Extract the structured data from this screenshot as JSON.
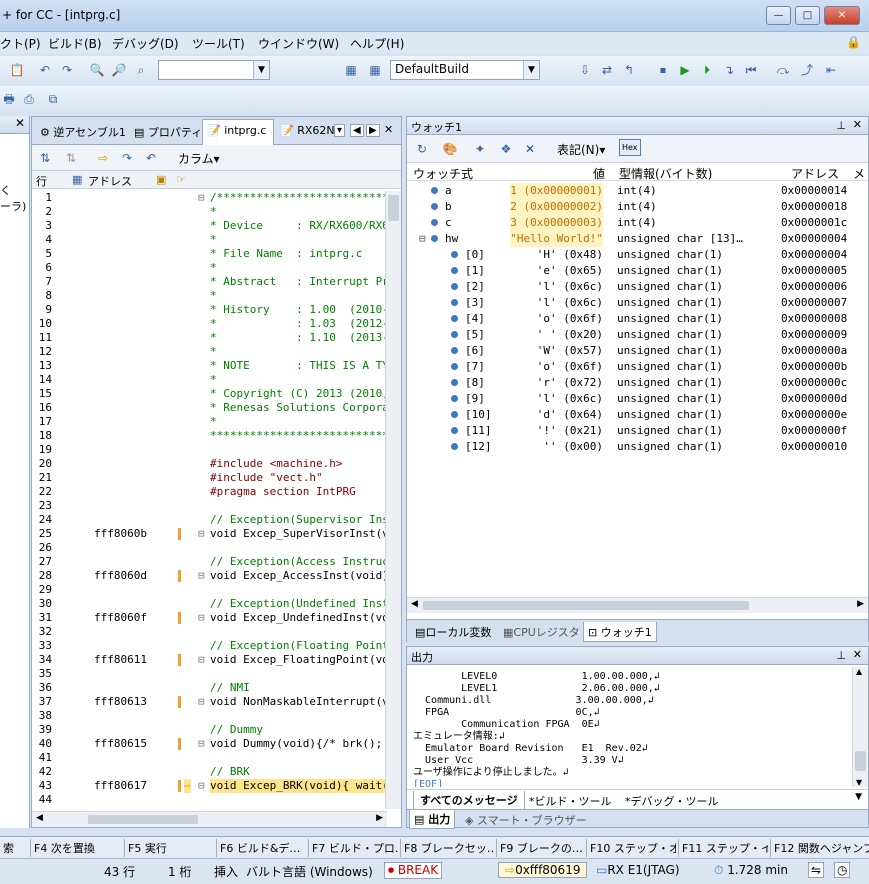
{
  "window": {
    "title": "+ for CC - [intprg.c]"
  },
  "menu": [
    "クト(P)",
    "ビルド(B)",
    "デバッグ(D)",
    "ツール(T)",
    "ウインドウ(W)",
    "ヘルプ(H)"
  ],
  "toolbar": {
    "build_config": "DefaultBuild"
  },
  "left_panel": {
    "items": [
      "く",
      "ーラ)"
    ]
  },
  "editor": {
    "tabs": [
      "逆アセンブル1",
      "プロパティ",
      "intprg.c",
      "RX62N_"
    ],
    "column_label": "カラム",
    "headers": {
      "line": "行",
      "address": "アドレス"
    },
    "lines": [
      {
        "n": "1",
        "addr": "",
        "text": "/***********************************",
        "cls": "cm",
        "fold": "⊟"
      },
      {
        "n": "2",
        "addr": "",
        "text": "*",
        "cls": "cm"
      },
      {
        "n": "3",
        "addr": "",
        "text": "* Device     : RX/RX600/RX62N",
        "cls": "cm"
      },
      {
        "n": "4",
        "addr": "",
        "text": "*",
        "cls": "cm"
      },
      {
        "n": "5",
        "addr": "",
        "text": "* File Name  : intprg.c",
        "cls": "cm"
      },
      {
        "n": "6",
        "addr": "",
        "text": "*",
        "cls": "cm"
      },
      {
        "n": "7",
        "addr": "",
        "text": "* Abstract   : Interrupt Pr",
        "cls": "cm"
      },
      {
        "n": "8",
        "addr": "",
        "text": "*",
        "cls": "cm"
      },
      {
        "n": "9",
        "addr": "",
        "text": "* History    : 1.00  (2010-",
        "cls": "cm"
      },
      {
        "n": "10",
        "addr": "",
        "text": "*            : 1.03  (2012-",
        "cls": "cm"
      },
      {
        "n": "11",
        "addr": "",
        "text": "*            : 1.10  (2013-",
        "cls": "cm"
      },
      {
        "n": "12",
        "addr": "",
        "text": "*",
        "cls": "cm"
      },
      {
        "n": "13",
        "addr": "",
        "text": "* NOTE       : THIS IS A TY",
        "cls": "cm"
      },
      {
        "n": "14",
        "addr": "",
        "text": "*",
        "cls": "cm"
      },
      {
        "n": "15",
        "addr": "",
        "text": "* Copyright (C) 2013 (2010,",
        "cls": "cm"
      },
      {
        "n": "16",
        "addr": "",
        "text": "* Renesas Solutions Corpora",
        "cls": "cm"
      },
      {
        "n": "17",
        "addr": "",
        "text": "*",
        "cls": "cm"
      },
      {
        "n": "18",
        "addr": "",
        "text": "***********************************",
        "cls": "cm"
      },
      {
        "n": "19",
        "addr": "",
        "text": "",
        "cls": ""
      },
      {
        "n": "20",
        "addr": "",
        "text": "#include <machine.h>",
        "cls": "pp"
      },
      {
        "n": "21",
        "addr": "",
        "text": "#include \"vect.h\"",
        "cls": "pp"
      },
      {
        "n": "22",
        "addr": "",
        "text": "#pragma section IntPRG",
        "cls": "pp"
      },
      {
        "n": "23",
        "addr": "",
        "text": "",
        "cls": ""
      },
      {
        "n": "24",
        "addr": "",
        "text": "// Exception(Supervisor Ins",
        "cls": "cm"
      },
      {
        "n": "25",
        "addr": "fff8060b",
        "text": "void Excep_SuperVisorInst(vo",
        "cls": "",
        "fold": "⊟",
        "mark": true
      },
      {
        "n": "26",
        "addr": "",
        "text": "",
        "cls": ""
      },
      {
        "n": "27",
        "addr": "",
        "text": "// Exception(Access Instruc",
        "cls": "cm"
      },
      {
        "n": "28",
        "addr": "fff8060d",
        "text": "void Excep_AccessInst(void)",
        "cls": "",
        "fold": "⊟",
        "mark": true
      },
      {
        "n": "29",
        "addr": "",
        "text": "",
        "cls": ""
      },
      {
        "n": "30",
        "addr": "",
        "text": "// Exception(Undefined Inst",
        "cls": "cm"
      },
      {
        "n": "31",
        "addr": "fff8060f",
        "text": "void Excep_UndefinedInst(vo",
        "cls": "",
        "fold": "⊟",
        "mark": true
      },
      {
        "n": "32",
        "addr": "",
        "text": "",
        "cls": ""
      },
      {
        "n": "33",
        "addr": "",
        "text": "// Exception(Floating Point",
        "cls": "cm"
      },
      {
        "n": "34",
        "addr": "fff80611",
        "text": "void Excep_FloatingPoint(vo",
        "cls": "",
        "fold": "⊟",
        "mark": true
      },
      {
        "n": "35",
        "addr": "",
        "text": "",
        "cls": ""
      },
      {
        "n": "36",
        "addr": "",
        "text": "// NMI",
        "cls": "cm"
      },
      {
        "n": "37",
        "addr": "fff80613",
        "text": "void NonMaskableInterrupt(v",
        "cls": "",
        "fold": "⊟",
        "mark": true
      },
      {
        "n": "38",
        "addr": "",
        "text": "",
        "cls": ""
      },
      {
        "n": "39",
        "addr": "",
        "text": "// Dummy",
        "cls": "cm"
      },
      {
        "n": "40",
        "addr": "fff80615",
        "text": "void Dummy(void){/* brk();",
        "cls": "",
        "fold": "⊟",
        "mark": true
      },
      {
        "n": "41",
        "addr": "",
        "text": "",
        "cls": ""
      },
      {
        "n": "42",
        "addr": "",
        "text": "// BRK",
        "cls": "cm"
      },
      {
        "n": "43",
        "addr": "fff80617",
        "text": "void Excep_BRK(void){ wait(",
        "cls": "",
        "fold": "⊟",
        "mark": true,
        "current": true
      },
      {
        "n": "44",
        "addr": "",
        "text": "",
        "cls": ""
      },
      {
        "n": "45",
        "addr": "",
        "text": "// RSC RUSEDD",
        "cls": "cm"
      }
    ]
  },
  "watch": {
    "title": "ウォッチ1",
    "notation_label": "表記(N)",
    "headers": {
      "expr": "ウォッチ式",
      "value": "値",
      "type": "型情報(バイト数)",
      "address": "アドレス",
      "more": "メ"
    },
    "rows": [
      {
        "name": "a",
        "value": "1 (0x00000001)",
        "type": "int(4)",
        "addr": "0x00000014",
        "indent": 0,
        "hl": true
      },
      {
        "name": "b",
        "value": "2 (0x00000002)",
        "type": "int(4)",
        "addr": "0x00000018",
        "indent": 0,
        "hl": true
      },
      {
        "name": "c",
        "value": "3 (0x00000003)",
        "type": "int(4)",
        "addr": "0x0000001c",
        "indent": 0,
        "hl": true
      },
      {
        "name": "hw",
        "value": "\"Hello World!\"",
        "type": "unsigned char [13]…",
        "addr": "0x00000004",
        "indent": 0,
        "hl": true,
        "expand": true
      },
      {
        "name": "[0]",
        "value": "'H' (0x48)",
        "type": "unsigned char(1)",
        "addr": "0x00000004",
        "indent": 1
      },
      {
        "name": "[1]",
        "value": "'e' (0x65)",
        "type": "unsigned char(1)",
        "addr": "0x00000005",
        "indent": 1
      },
      {
        "name": "[2]",
        "value": "'l' (0x6c)",
        "type": "unsigned char(1)",
        "addr": "0x00000006",
        "indent": 1
      },
      {
        "name": "[3]",
        "value": "'l' (0x6c)",
        "type": "unsigned char(1)",
        "addr": "0x00000007",
        "indent": 1
      },
      {
        "name": "[4]",
        "value": "'o' (0x6f)",
        "type": "unsigned char(1)",
        "addr": "0x00000008",
        "indent": 1
      },
      {
        "name": "[5]",
        "value": "' ' (0x20)",
        "type": "unsigned char(1)",
        "addr": "0x00000009",
        "indent": 1
      },
      {
        "name": "[6]",
        "value": "'W' (0x57)",
        "type": "unsigned char(1)",
        "addr": "0x0000000a",
        "indent": 1
      },
      {
        "name": "[7]",
        "value": "'o' (0x6f)",
        "type": "unsigned char(1)",
        "addr": "0x0000000b",
        "indent": 1
      },
      {
        "name": "[8]",
        "value": "'r' (0x72)",
        "type": "unsigned char(1)",
        "addr": "0x0000000c",
        "indent": 1
      },
      {
        "name": "[9]",
        "value": "'l' (0x6c)",
        "type": "unsigned char(1)",
        "addr": "0x0000000d",
        "indent": 1
      },
      {
        "name": "[10]",
        "value": "'d' (0x64)",
        "type": "unsigned char(1)",
        "addr": "0x0000000e",
        "indent": 1
      },
      {
        "name": "[11]",
        "value": "'!' (0x21)",
        "type": "unsigned char(1)",
        "addr": "0x0000000f",
        "indent": 1
      },
      {
        "name": "[12]",
        "value": "'' (0x00)",
        "type": "unsigned char(1)",
        "addr": "0x00000010",
        "indent": 1
      }
    ],
    "tabs": [
      "ローカル変数",
      "CPUレジスタ",
      "ウォッチ1"
    ]
  },
  "output": {
    "title": "出力",
    "lines": [
      "        LEVEL0              1.00.00.000,↲",
      "        LEVEL1              2.06.00.000,↲",
      "  Communi.dll              3.00.00.000,↲",
      "  FPGA                     0C,↲",
      "        Communication FPGA  0E↲",
      "エミュレータ情報:↲",
      "  Emulator Board Revision   E1  Rev.02↲",
      "  User Vcc                  3.39 V↲",
      "ユーザ操作により停止しました。↲",
      "[EOF]"
    ],
    "tabs": [
      "すべてのメッセージ",
      "*ビルド・ツール",
      "*デバッグ・ツール"
    ],
    "bottom_tabs": [
      "出力",
      "スマート・ブラウザー"
    ]
  },
  "fkeys": [
    "索",
    "F4 次を置換",
    "F5 実行",
    "F6 ビルド&デ…",
    "F7 ビルド・プロ…",
    "F8 ブレークセッ…",
    "F9 ブレークの…",
    "F10 ステップ・オ…",
    "F11 ステップ・イン",
    "F12 関数へジャンプ"
  ],
  "status": {
    "line": "43 行",
    "col": "1 桁",
    "mode": "挿入",
    "lang": "バルト言語 (Windows)",
    "state": "BREAK",
    "pc": "0xfff80619",
    "target": "RX E1(JTAG)",
    "time": "1.728 min"
  },
  "colors": {
    "accent": "#3f78c0",
    "break": "#d00000",
    "highlight": "#fff3c2"
  }
}
